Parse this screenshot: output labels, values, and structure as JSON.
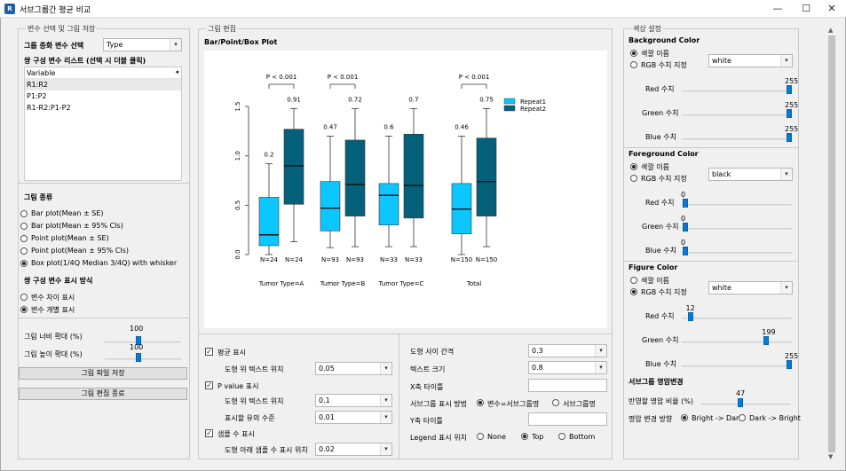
{
  "window": {
    "title": "서브그룹간 평균 비교",
    "minimize": "—",
    "maximize": "☐",
    "close": "✕"
  },
  "left": {
    "group_title": "변수 선택 및 그림 저장",
    "grouping_label": "그룹 층화 변수 선택",
    "grouping_value": "Type",
    "pair_list_label": "쌍 구성 변수 리스트 (선택 시 더블 클릭)",
    "list_header": "Variable",
    "list_items": [
      "R1:R2",
      "P1:P2",
      "R1-R2:P1-P2"
    ],
    "plot_type_label": "그림 종류",
    "plot_types": [
      {
        "label": "Bar plot(Mean ± SE)",
        "checked": false
      },
      {
        "label": "Bar plot(Mean ± 95% CIs)",
        "checked": false
      },
      {
        "label": "Point plot(Mean ± SE)",
        "checked": false
      },
      {
        "label": "Point plot(Mean ± 95% CIs)",
        "checked": false
      },
      {
        "label": "Box plot(1/4Q Median 3/4Q) with whisker",
        "checked": true
      }
    ],
    "pair_display_label": "쌍 구성 변수 표시 방식",
    "pair_display": [
      {
        "label": "변수 차이 표시",
        "checked": false
      },
      {
        "label": "변수 개별 표시",
        "checked": true
      }
    ],
    "width_label": "그림 너비 확대 (%)",
    "width_value": "100",
    "width_level": 0.5,
    "height_label": "그림 높이 확대 (%)",
    "height_value": "100",
    "height_level": 0.5,
    "save_button": "그림 파일 저장",
    "close_button": "그림 편집 종료"
  },
  "middle": {
    "group_title": "그림 편집",
    "plot_title": "Bar/Point/Box Plot",
    "options": {
      "mean_label": "평균 표시",
      "mean_checked": true,
      "text_pos_label": "도형 위 텍스트 위치",
      "text_pos_value": "0.05",
      "pvalue_label": "P value 표시",
      "pvalue_checked": true,
      "pvalue_pos_label": "도형 위 텍스트 위치",
      "pvalue_pos_value": "0.1",
      "sig_label": "표시할 유의 수준",
      "sig_value": "0.01",
      "n_label": "샘플 수 표시",
      "n_checked": true,
      "n_pos_label": "도형 아래 샘플 수 표시 위치",
      "n_pos_value": "0.02",
      "spacing_label": "도형 사이 간격",
      "spacing_value": "0.3",
      "textsize_label": "텍스트 크기",
      "textsize_value": "0.8",
      "xtitle_label": "X축 타이틀",
      "xtitle_value": "",
      "subgroup_label": "서브그룹 표시 방법",
      "subgroup_opt1": "변수=서브그룹명",
      "subgroup_opt1_on": true,
      "subgroup_opt2": "서브그룹명",
      "subgroup_opt2_on": false,
      "ytitle_label": "Y축 타이틀",
      "ytitle_value": "",
      "legend_label": "Legend 표시 위치",
      "legend_none": "None",
      "legend_top": "Top",
      "legend_bottom": "Bottom",
      "legend_selected": "Top"
    }
  },
  "right": {
    "group_title": "색상 설정",
    "bg": {
      "title": "Background Color",
      "name_opt": "색깔 이름",
      "rgb_opt": "RGB 수치 지정",
      "mode": "name",
      "combo": "white",
      "red_label": "Red 수치",
      "red": "255",
      "green_label": "Green 수치",
      "green": "255",
      "blue_label": "Blue 수치",
      "blue": "255"
    },
    "fg": {
      "title": "Foreground Color",
      "name_opt": "색깔 이름",
      "rgb_opt": "RGB 수치 지정",
      "mode": "name",
      "combo": "black",
      "red_label": "Red 수치",
      "red": "0",
      "green_label": "Green 수치",
      "green": "0",
      "blue_label": "Blue 수치",
      "blue": "0"
    },
    "fig": {
      "title": "Figure Color",
      "name_opt": "색깔 이름",
      "rgb_opt": "RGB 수치 지정",
      "mode": "rgb",
      "combo": "white",
      "red_label": "Red 수치",
      "red": "12",
      "green_label": "Green 수치",
      "green": "199",
      "blue_label": "Blue 수치",
      "blue": "255"
    },
    "bright": {
      "title": "서브그룹 명암변경",
      "ratio_label": "반영할 명암 비율 (%)",
      "ratio_value": "47",
      "dir_label": "명암 변경 방향",
      "dir_opt1": "Bright -> Dark",
      "dir_opt2": "Dark -> Bright",
      "dir_selected": 1
    }
  },
  "chart_data": {
    "type": "box",
    "title": "",
    "categories": [
      "Tumor Type=A",
      "Tumor Type=B",
      "Tumor Type=C",
      "Total"
    ],
    "series": [
      {
        "name": "Repeat1",
        "color": "#0cc7ff",
        "whisker_low": [
          0.0,
          0.07,
          0.08,
          0.0
        ],
        "q1": [
          0.09,
          0.24,
          0.3,
          0.21
        ],
        "median": [
          0.2,
          0.47,
          0.6,
          0.46
        ],
        "q3": [
          0.58,
          0.74,
          0.72,
          0.72
        ],
        "whisker_high": [
          0.92,
          1.2,
          1.2,
          1.2
        ],
        "mean": [
          0.2,
          0.47,
          0.6,
          0.46
        ],
        "n": [
          "N=24",
          "N=93",
          "N=33",
          "N=150"
        ]
      },
      {
        "name": "Repeat2",
        "color": "#05607a",
        "whisker_low": [
          0.13,
          0.08,
          0.08,
          0.08
        ],
        "q1": [
          0.51,
          0.39,
          0.37,
          0.39
        ],
        "median": [
          0.9,
          0.71,
          0.7,
          0.74
        ],
        "q3": [
          1.27,
          1.16,
          1.22,
          1.18
        ],
        "whisker_high": [
          1.48,
          1.48,
          1.48,
          1.48
        ],
        "mean": [
          0.91,
          0.72,
          0.7,
          0.75
        ],
        "n": [
          "N=24",
          "N=93",
          "N=33",
          "N=150"
        ]
      }
    ],
    "pvalues": [
      "P < 0.001",
      "P < 0.001",
      "",
      "P < 0.001"
    ],
    "yticks": [
      "0.0",
      "0.5",
      "1.0",
      "1.5"
    ],
    "ylim": [
      0.0,
      1.6
    ],
    "legend": "top-right"
  }
}
